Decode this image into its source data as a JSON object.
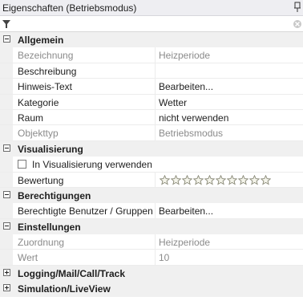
{
  "panel": {
    "title": "Eigenschaften (Betriebsmodus)",
    "pin_icon": "pin-icon",
    "filter_icon": "filter-icon",
    "clear_icon": "clear-icon"
  },
  "categories": [
    {
      "label": "Allgemein",
      "expanded": true,
      "properties": [
        {
          "name": "Bezeichnung",
          "value": "Heizperiode",
          "readonly": true
        },
        {
          "name": "Beschreibung",
          "value": ""
        },
        {
          "name": "Hinweis-Text",
          "value": "Bearbeiten..."
        },
        {
          "name": "Kategorie",
          "value": "Wetter"
        },
        {
          "name": "Raum",
          "value": "nicht verwenden"
        },
        {
          "name": "Objekttyp",
          "value": "Betriebsmodus",
          "readonly": true
        }
      ]
    },
    {
      "label": "Visualisierung",
      "expanded": true,
      "properties": [
        {
          "checkbox_label": "In Visualisierung verwenden",
          "checked": false
        },
        {
          "name": "Bewertung",
          "rating_stars": 10,
          "rating_value": 0
        }
      ]
    },
    {
      "label": "Berechtigungen",
      "expanded": true,
      "properties": [
        {
          "name": "Berechtigte Benutzer / Gruppen",
          "value": "Bearbeiten..."
        }
      ]
    },
    {
      "label": "Einstellungen",
      "expanded": true,
      "properties": [
        {
          "name": "Zuordnung",
          "value": "Heizperiode",
          "readonly": true
        },
        {
          "name": "Wert",
          "value": "10",
          "readonly": true
        }
      ]
    },
    {
      "label": "Logging/Mail/Call/Track",
      "expanded": false
    },
    {
      "label": "Simulation/LiveView",
      "expanded": false
    }
  ],
  "colors": {
    "category_bg": "#f0f0f0",
    "disabled_text": "#8b8b8b",
    "star_stroke": "#8a8a78"
  }
}
